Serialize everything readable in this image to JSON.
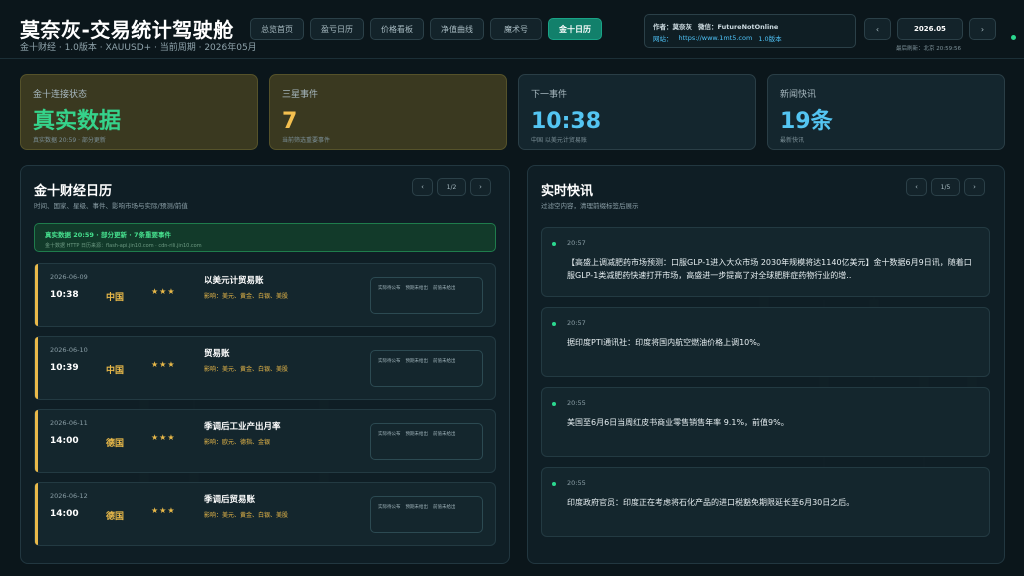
{
  "header": {
    "title": "莫奈灰-交易统计驾驶舱",
    "subtitle": "金十财经 · 1.0版本 · XAUUSD+ · 当前周期 · 2026年05月",
    "nav": [
      "总览首页",
      "盈亏日历",
      "价格看板",
      "净值曲线",
      "魔术号",
      "金十日历"
    ],
    "active_nav": "金十日历"
  },
  "info_box": {
    "author_label": "作者：莫奈灰",
    "wechat_label": "微信：FutureNotOnline",
    "site_label": "网站：",
    "site_url": "https://www.1mt5.com",
    "version": "1.0版本"
  },
  "date_nav": {
    "prev": "‹",
    "date": "2026.05",
    "next": "›",
    "update_time": "最后刷新：北京 20:59:56"
  },
  "stats": [
    {
      "label": "金十连接状态",
      "value": "真实数据",
      "sub": "真实数据 20:59 · 部分更新"
    },
    {
      "label": "三星事件",
      "value": "7",
      "sub": "当前筛选重要事件"
    },
    {
      "label": "下一事件",
      "value": "10:38",
      "sub": "中国 以美元计贸易账"
    },
    {
      "label": "新闻快讯",
      "value": "19条",
      "sub": "最新快讯"
    }
  ],
  "calendar": {
    "title": "金十财经日历",
    "subtitle": "时间、国家、星级、事件、影响市场与实际/预测/前值",
    "pager": {
      "prev": "‹",
      "page": "1/2",
      "next": "›"
    },
    "status_main": "真实数据 20:59 · 部分更新 · 7条重要事件",
    "status_src": "金十数据 HTTP 日历来源：flash-api.jin10.com · cdn-rili.jin10.com",
    "events": [
      {
        "date": "2026-06-09",
        "time": "10:38",
        "country": "中国",
        "stars": "★★★",
        "name": "以美元计贸易账",
        "impact": "影响：美元、黄金、白银、美股",
        "actual": "实际待公布",
        "forecast": "预期未给出",
        "previous": "前值未给出"
      },
      {
        "date": "2026-06-10",
        "time": "10:39",
        "country": "中国",
        "stars": "★★★",
        "name": "贸易账",
        "impact": "影响：美元、黄金、白银、美股",
        "actual": "实际待公布",
        "forecast": "预期未给出",
        "previous": "前值未给出"
      },
      {
        "date": "2026-06-11",
        "time": "14:00",
        "country": "德国",
        "stars": "★★★",
        "name": "季调后工业产出月率",
        "impact": "影响：欧元、德指、金银",
        "actual": "实际待公布",
        "forecast": "预期未给出",
        "previous": "前值未给出"
      },
      {
        "date": "2026-06-12",
        "time": "14:00",
        "country": "德国",
        "stars": "★★★",
        "name": "季调后贸易账",
        "impact": "影响：美元、黄金、白银、美股",
        "actual": "实际待公布",
        "forecast": "预期未给出",
        "previous": "前值未给出"
      }
    ]
  },
  "news": {
    "title": "实时快讯",
    "subtitle": "过滤空内容，清理前缀标签后展示",
    "pager": {
      "prev": "‹",
      "page": "1/5",
      "next": "›"
    },
    "items": [
      {
        "time": "20:57",
        "text": "【高盛上调减肥药市场预测：口服GLP-1进入大众市场 2030年规模将达1140亿美元】金十数据6月9日讯，随着口服GLP-1类减肥药快速打开市场，高盛进一步提高了对全球肥胖症药物行业的增.."
      },
      {
        "time": "20:57",
        "text": "据印度PTI通讯社：印度将国内航空燃油价格上调10%。"
      },
      {
        "time": "20:55",
        "text": "美国至6月6日当周红皮书商业零售销售年率 9.1%，前值9%。"
      },
      {
        "time": "20:55",
        "text": "印度政府官员：印度正在考虑将石化产品的进口税豁免期限延长至6月30日之后。"
      }
    ]
  }
}
